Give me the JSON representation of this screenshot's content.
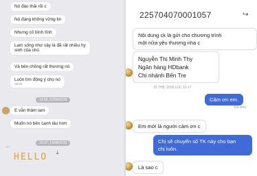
{
  "left": {
    "messages": [
      {
        "text": "Nó đào thải rồi c"
      },
      {
        "text": "Nó đang không vững tin"
      },
      {
        "text": "Nhưng cố bình tĩnh"
      },
      {
        "lines": [
          "Lam sống như vậy là đã rất nhiều hy",
          "sinh của chú"
        ]
      },
      {
        "text": "Và bên chồng rất thương nó"
      },
      {
        "text": "Luôn tìm động ý cho nó"
      },
      {
        "text": "E vẫn thâm lam"
      },
      {
        "text": "Muốn nó bên cạnh lâu hơn"
      }
    ],
    "time_1": "15:02",
    "date_separator_1": "13:56, 22/09/2018",
    "date_separator_2": "10:17, 16/08/2019",
    "sticker_text": "HELLO"
  },
  "right": {
    "account_number": "225704070001057",
    "share_icon": "share-icon",
    "msg1_lines": [
      "Nội dung ck là gửi cho chương trình",
      "một nữa yêu thương nha c"
    ],
    "msg2_lines": [
      "Nguyễn Thị Minh Thy",
      "Ngân hàng HDbank",
      "Chi nhánh Bến Tre"
    ],
    "timestamp": "15 TH8, 2018 LÚC 10:17",
    "sent_1": "Cảm ơn em.",
    "seen_label": "Đã xem",
    "reply_1": "Em mới là người cảm ơn c",
    "sent_2_lines": [
      "Chị sẽ chuyển số TK này cho bạn",
      "chị luôn."
    ],
    "reply_2": "Là sao c"
  },
  "colors": {
    "accent_blue": "#3f6ad8"
  }
}
